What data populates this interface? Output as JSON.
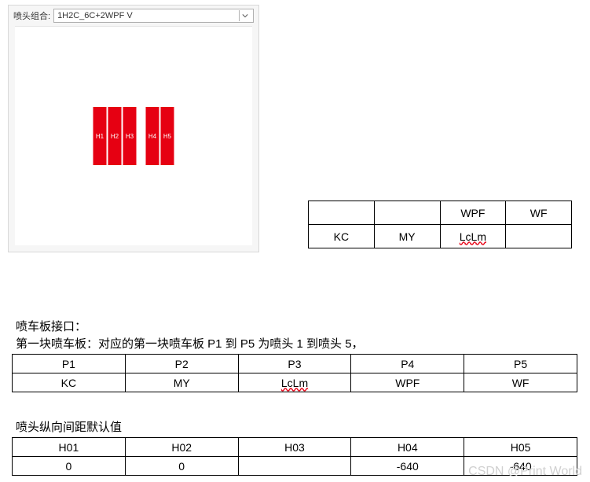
{
  "app": {
    "dropdown": {
      "label": "喷头组合:",
      "value": "1H2C_6C+2WPF V"
    },
    "heads": [
      "H1",
      "H2",
      "H3",
      "H4",
      "H5"
    ]
  },
  "small_table": {
    "row0": [
      "",
      "",
      "WPF",
      "WF"
    ],
    "row1": [
      "KC",
      "MY",
      "LcLm",
      ""
    ]
  },
  "text": {
    "line1": "喷车板接口：",
    "line2": "第一块喷车板：对应的第一块喷车板 P1 到 P5 为喷头 1 到喷头 5，",
    "line3": "喷头纵向间距默认值"
  },
  "table_a": {
    "header": [
      "P1",
      "P2",
      "P3",
      "P4",
      "P5"
    ],
    "row": [
      "KC",
      "MY",
      "LcLm",
      "WPF",
      "WF"
    ]
  },
  "table_b": {
    "header": [
      "H01",
      "H02",
      "H03",
      "H04",
      "H05"
    ],
    "row": [
      "0",
      "0",
      "",
      "-640",
      "-640"
    ]
  },
  "watermark": "CSDN @Print World"
}
